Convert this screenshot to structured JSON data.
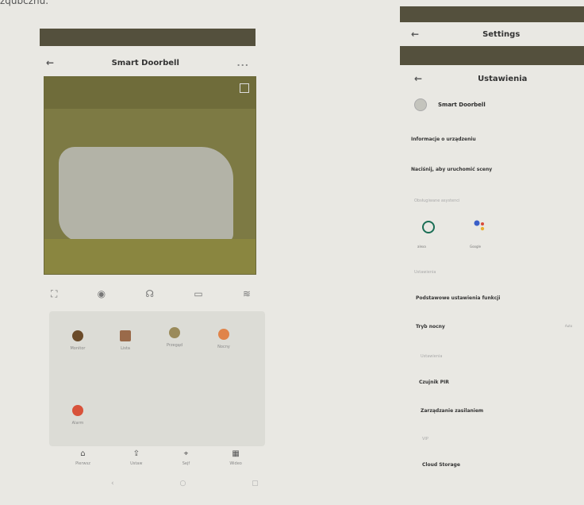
{
  "stray_text": "zqubcznu.",
  "left": {
    "header": {
      "title": "Smart Doorbell",
      "more": "..."
    },
    "controls": [
      "⛶",
      "◉",
      "☊",
      "▭",
      "≋"
    ],
    "functions": [
      {
        "label": "Monitor",
        "color": "#6b4b2a"
      },
      {
        "label": "Lista",
        "color": "#9a6a4a"
      },
      {
        "label": "Przegąd",
        "color": "#9a8a5a"
      },
      {
        "label": "Nocny",
        "color": "#e0844a"
      },
      {
        "label": "Alarm",
        "color": "#d8523a"
      }
    ],
    "nav": [
      {
        "icon": "⌂",
        "label": "Pierwsz"
      },
      {
        "icon": "⇪",
        "label": "Ustaw"
      },
      {
        "icon": "⌖",
        "label": "Sejf"
      },
      {
        "icon": "▦",
        "label": "Wideo"
      }
    ]
  },
  "right": {
    "settings_title": "Settings",
    "ustawienia_title": "Ustawienia",
    "device_name": "Smart Doorbell",
    "info": "Informacje o urządzeniu",
    "tap_text": "Naciśnij, aby uruchomić sceny",
    "section1": "Obsługiwane asystenci",
    "alexa_label": "alexa",
    "google_label": "Google",
    "section2": "Ustawienia",
    "advanced": "Podstawowe ustawienia funkcji",
    "night": "Tryb nocny",
    "night_value": "Auto",
    "section3": "Ustawienia",
    "pir": "Czujnik PIR",
    "power": "Zarządzanie zasilaniem",
    "section4": "VIP",
    "cloud": "Cloud Storage"
  }
}
